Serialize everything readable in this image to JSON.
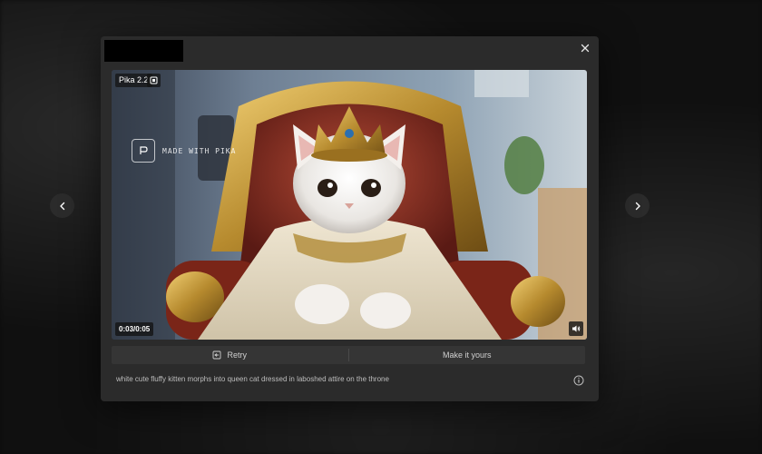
{
  "model_badge": "Pika 2.2",
  "watermark": "MADE WITH PIKA",
  "time": "0:03/0:05",
  "actions": {
    "retry_label": "Retry",
    "make_label": "Make it yours"
  },
  "prompt": "white cute fluffy kitten morphs into queen cat dressed in laboshed attire on the throne",
  "icons": {
    "close": "close-icon",
    "prev": "chevron-left-icon",
    "next": "chevron-right-icon",
    "copy": "copy-icon",
    "volume": "speaker-icon",
    "retry": "retry-icon",
    "info": "info-icon"
  }
}
